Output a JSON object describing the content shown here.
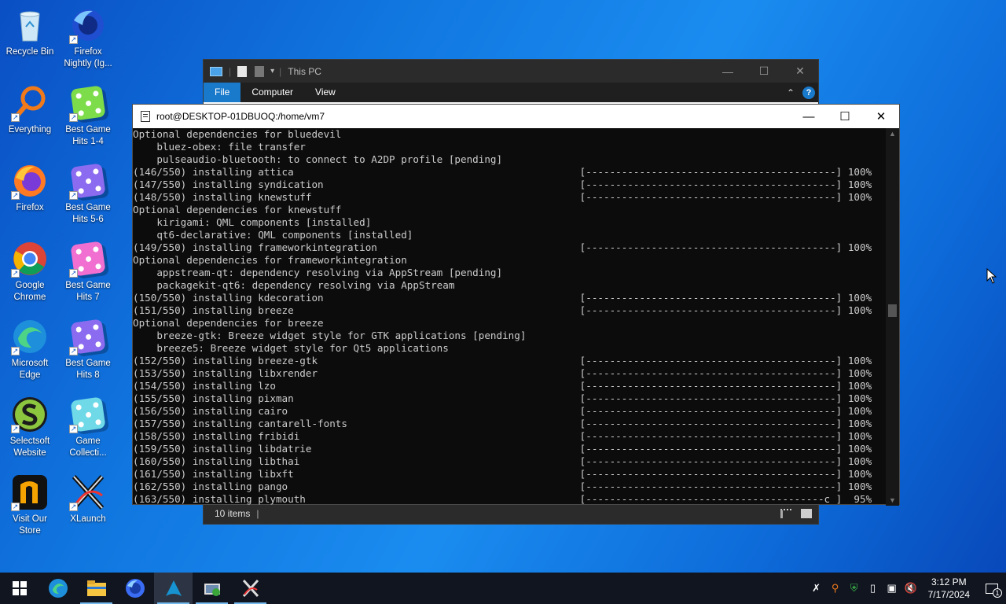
{
  "desktop_icons": [
    {
      "label": "Recycle Bin",
      "icon": "recycle-bin-icon"
    },
    {
      "label": "Firefox\nNightly (Ig...",
      "icon": "firefox-nightly-icon"
    },
    {
      "label": "Everything",
      "icon": "everything-search-icon"
    },
    {
      "label": "Best Game\nHits 1-4",
      "icon": "dice-icon"
    },
    {
      "label": "Firefox",
      "icon": "firefox-icon"
    },
    {
      "label": "Best Game\nHits 5-6",
      "icon": "dice-icon"
    },
    {
      "label": "Google\nChrome",
      "icon": "chrome-icon"
    },
    {
      "label": "Best Game\nHits 7",
      "icon": "dice-icon"
    },
    {
      "label": "Microsoft\nEdge",
      "icon": "edge-icon"
    },
    {
      "label": "Best Game\nHits 8",
      "icon": "dice-icon"
    },
    {
      "label": "Selectsoft\nWebsite",
      "icon": "selectsoft-icon"
    },
    {
      "label": "Game\nCollecti...",
      "icon": "dice-icon"
    },
    {
      "label": "Visit Our\nStore",
      "icon": "store-icon"
    },
    {
      "label": "XLaunch",
      "icon": "xlaunch-icon"
    }
  ],
  "explorer": {
    "title": "This PC",
    "tabs": [
      "File",
      "Computer",
      "View"
    ],
    "status": "10 items"
  },
  "terminal": {
    "title": "root@DESKTOP-01DBUOQ:/home/vm7",
    "lines": [
      "Optional dependencies for bluedevil",
      "    bluez-obex: file transfer",
      "    pulseaudio-bluetooth: to connect to A2DP profile [pending]",
      "(146/550) installing attica                                                [------------------------------------------] 100%",
      "(147/550) installing syndication                                           [------------------------------------------] 100%",
      "(148/550) installing knewstuff                                             [------------------------------------------] 100%",
      "Optional dependencies for knewstuff",
      "    kirigami: QML components [installed]",
      "    qt6-declarative: QML components [installed]",
      "(149/550) installing frameworkintegration                                  [------------------------------------------] 100%",
      "Optional dependencies for frameworkintegration",
      "    appstream-qt: dependency resolving via AppStream [pending]",
      "    packagekit-qt6: dependency resolving via AppStream",
      "(150/550) installing kdecoration                                           [------------------------------------------] 100%",
      "(151/550) installing breeze                                                [------------------------------------------] 100%",
      "Optional dependencies for breeze",
      "    breeze-gtk: Breeze widget style for GTK applications [pending]",
      "    breeze5: Breeze widget style for Qt5 applications",
      "(152/550) installing breeze-gtk                                            [------------------------------------------] 100%",
      "(153/550) installing libxrender                                            [------------------------------------------] 100%",
      "(154/550) installing lzo                                                   [------------------------------------------] 100%",
      "(155/550) installing pixman                                                [------------------------------------------] 100%",
      "(156/550) installing cairo                                                 [------------------------------------------] 100%",
      "(157/550) installing cantarell-fonts                                       [------------------------------------------] 100%",
      "(158/550) installing fribidi                                               [------------------------------------------] 100%",
      "(159/550) installing libdatrie                                             [------------------------------------------] 100%",
      "(160/550) installing libthai                                               [------------------------------------------] 100%",
      "(161/550) installing libxft                                                [------------------------------------------] 100%",
      "(162/550) installing pango                                                 [------------------------------------------] 100%",
      "(163/550) installing plymouth                                              [----------------------------------------c ]  95%"
    ]
  },
  "taskbar": {
    "apps": [
      "start-icon",
      "edge-icon",
      "file-explorer-icon",
      "firefox-icon",
      "arch-terminal-icon",
      "computer-management-icon",
      "xlaunch-icon"
    ],
    "time": "3:12 PM",
    "date": "7/17/2024",
    "notifications": "1"
  }
}
